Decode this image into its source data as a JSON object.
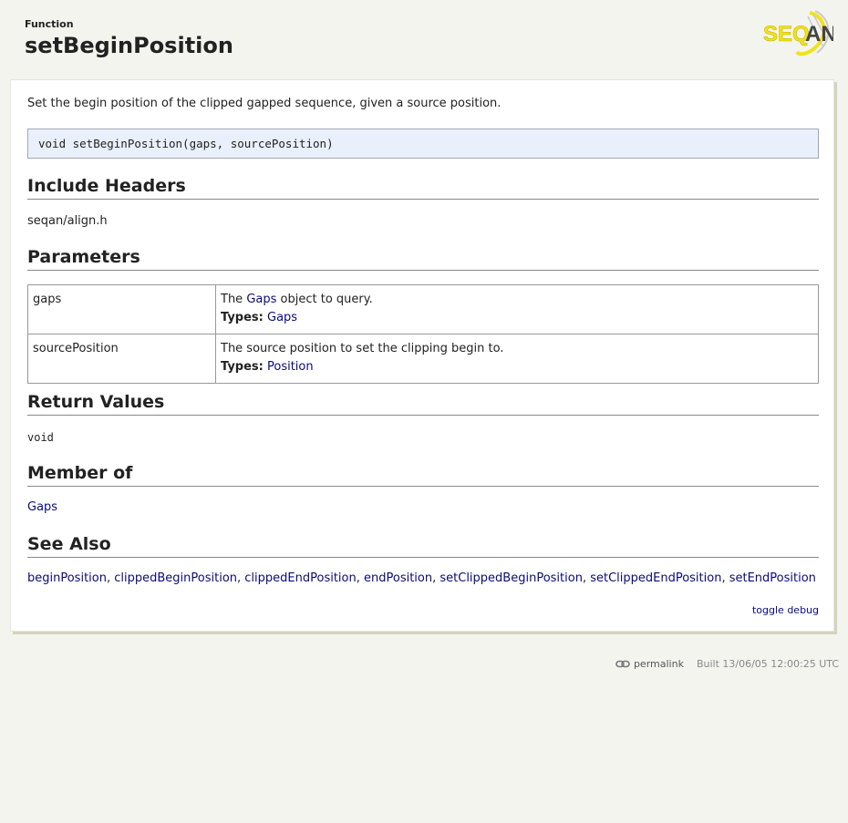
{
  "header": {
    "kind": "Function",
    "title": "setBeginPosition",
    "logo_text": "SEQAN"
  },
  "summary": "Set the begin position of the clipped gapped sequence, given a source position.",
  "signature": "void setBeginPosition(gaps, sourcePosition)",
  "sections": {
    "include_headers": {
      "heading": "Include Headers",
      "value": "seqan/align.h"
    },
    "parameters": {
      "heading": "Parameters",
      "rows": [
        {
          "name": "gaps",
          "desc_prefix": "The ",
          "desc_link": "Gaps",
          "desc_suffix": " object to query.",
          "types_label": "Types:",
          "types_value": "Gaps"
        },
        {
          "name": "sourcePosition",
          "desc_prefix": "The source position to set the clipping begin to.",
          "desc_link": "",
          "desc_suffix": "",
          "types_label": "Types:",
          "types_value": "Position"
        }
      ]
    },
    "return_values": {
      "heading": "Return Values",
      "value": "void"
    },
    "member_of": {
      "heading": "Member of",
      "link": "Gaps"
    },
    "see_also": {
      "heading": "See Also",
      "links": [
        "beginPosition",
        "clippedBeginPosition",
        "clippedEndPosition",
        "endPosition",
        "setClippedBeginPosition",
        "setClippedEndPosition",
        "setEndPosition"
      ],
      "separator": ", "
    }
  },
  "toggle_debug": "toggle debug",
  "footer": {
    "permalink": "permalink",
    "built": "Built 13/06/05 12:00:25 UTC"
  },
  "colors": {
    "background": "#f4f4ef",
    "link": "#0a0a7a",
    "signature_bg": "#e9f0fb",
    "logo_yellow": "#f1e21a"
  }
}
